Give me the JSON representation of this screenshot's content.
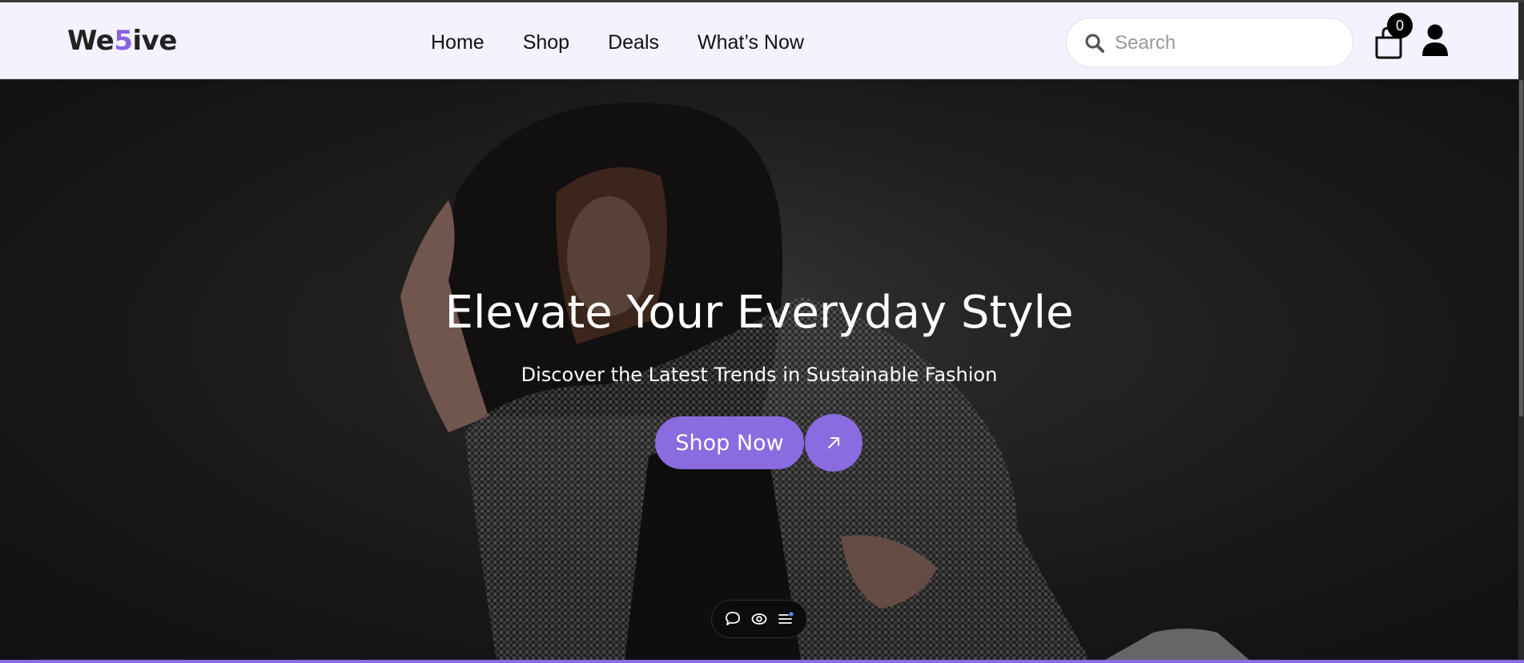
{
  "brand": {
    "logo_prefix": "We",
    "logo_accent": "5",
    "logo_suffix": "ive",
    "accent_color": "#8a63e0"
  },
  "nav": {
    "items": [
      {
        "label": "Home"
      },
      {
        "label": "Shop"
      },
      {
        "label": "Deals"
      },
      {
        "label": "What’s Now"
      }
    ]
  },
  "search": {
    "placeholder": "Search",
    "icon": "search-icon"
  },
  "cart": {
    "count": "0",
    "icon": "shopping-bag-icon"
  },
  "user": {
    "icon": "user-icon"
  },
  "hero": {
    "title": "Elevate Your Everyday Style",
    "subtitle": "Discover the Latest Trends in Sustainable Fashion",
    "cta_label": "Shop Now",
    "cta_arrow_icon": "arrow-up-right-icon",
    "button_color": "#8a6be0"
  },
  "floating_toolbar": {
    "icons": [
      "comment-icon",
      "eye-icon",
      "menu-lines-icon"
    ]
  }
}
